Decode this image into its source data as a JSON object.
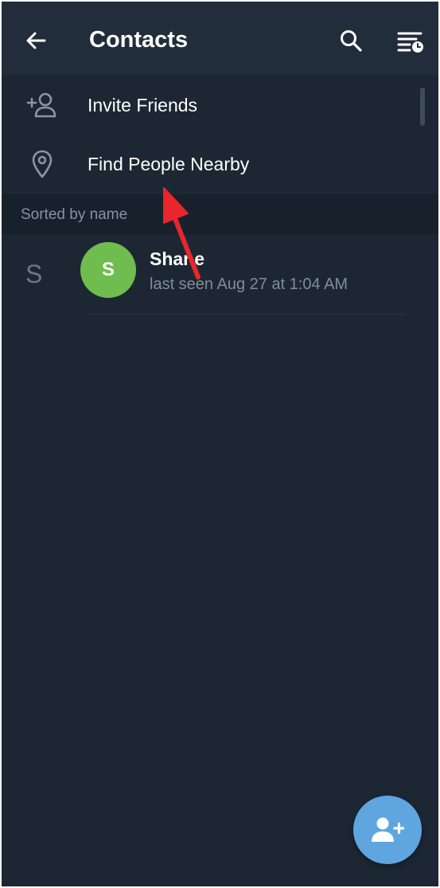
{
  "header": {
    "title": "Contacts",
    "back_icon": "arrow-left-icon",
    "search_icon": "search-icon",
    "sort_icon": "sort-by-time-icon"
  },
  "actions": [
    {
      "label": "Invite Friends",
      "icon": "add-person-icon"
    },
    {
      "label": "Find People Nearby",
      "icon": "location-pin-icon"
    }
  ],
  "section": {
    "label": "Sorted by name"
  },
  "contacts": [
    {
      "index_letter": "S",
      "avatar_initial": "S",
      "name": "Shane",
      "status": "last seen Aug 27 at 1:04 AM",
      "avatar_color": "#6fbd4e"
    }
  ],
  "fab": {
    "icon": "add-contact-icon"
  },
  "annotation": {
    "icon": "red-arrow-annotation",
    "color": "#e8262b"
  },
  "colors": {
    "background": "#1d2733",
    "app_bar": "#212d3b",
    "section_header": "#18212b",
    "fab": "#5fa5e0"
  }
}
